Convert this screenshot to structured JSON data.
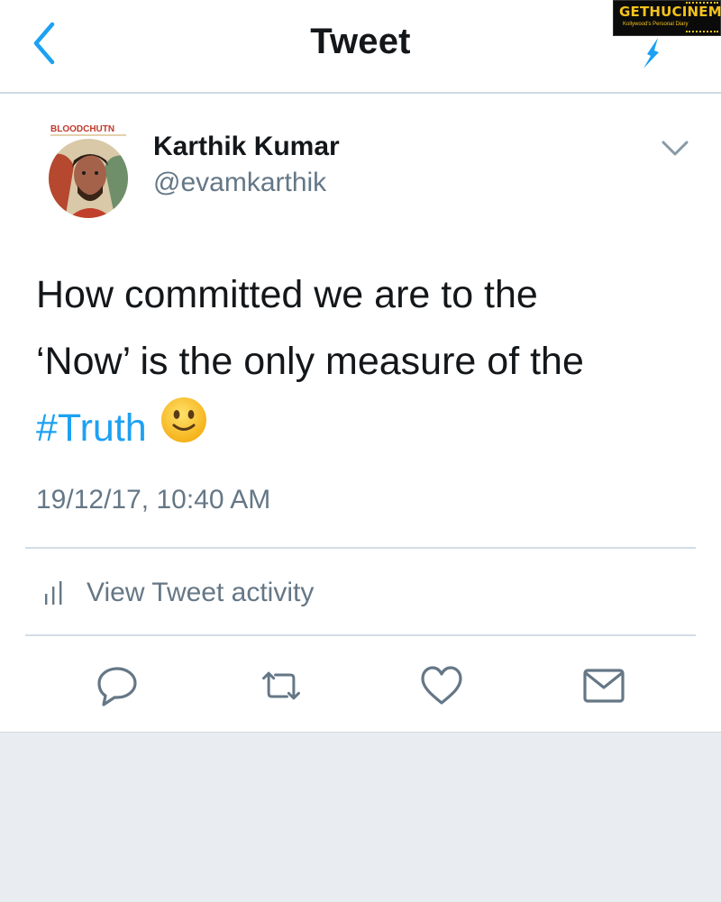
{
  "header": {
    "title": "Tweet",
    "back_icon": "chevron-left-icon",
    "compose_icon": "compose-icon"
  },
  "watermark": {
    "text": "GETHUCINEMA",
    "tagline": "Kollywood's Personal Diary",
    "color": "#f3c31c"
  },
  "author": {
    "name": "Karthik Kumar",
    "handle": "@evamkarthik",
    "avatar_caption": "BLOODCHUTN",
    "menu_icon": "chevron-down-icon"
  },
  "tweet": {
    "line1": "How committed we are to the",
    "line2": "‘Now’ is the only measure of the",
    "hashtag": "#Truth",
    "emoji_icon": "slightly-smiling-face-icon",
    "timestamp": "19/12/17, 10:40 AM"
  },
  "activity": {
    "label": "View Tweet activity",
    "icon": "bar-chart-icon"
  },
  "actions": [
    {
      "name": "reply",
      "icon": "reply-icon"
    },
    {
      "name": "retweet",
      "icon": "retweet-icon"
    },
    {
      "name": "like",
      "icon": "heart-icon"
    },
    {
      "name": "share",
      "icon": "mail-icon"
    }
  ],
  "colors": {
    "accent": "#1da1f2",
    "secondary_text": "#657786",
    "primary_text": "#14171a",
    "divider": "#d4dde5",
    "page_background": "#e9edf2"
  }
}
